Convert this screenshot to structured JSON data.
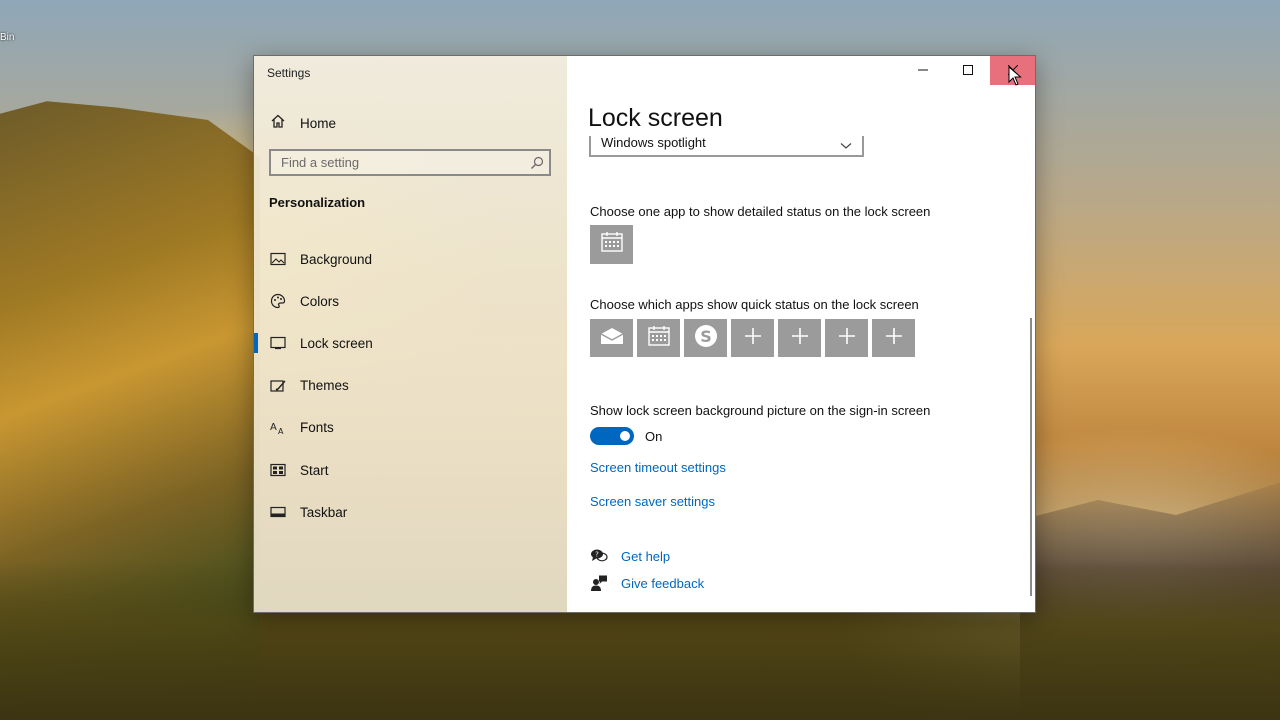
{
  "desktop": {
    "recycle_bin_label": "Bin"
  },
  "window": {
    "title": "Settings",
    "controls": {
      "minimize": "minimize-icon",
      "maximize": "maximize-icon",
      "close": "close-icon"
    }
  },
  "sidebar": {
    "home_label": "Home",
    "search_placeholder": "Find a setting",
    "section_title": "Personalization",
    "items": [
      {
        "label": "Background",
        "icon": "background-picture-icon"
      },
      {
        "label": "Colors",
        "icon": "palette-icon"
      },
      {
        "label": "Lock screen",
        "icon": "lock-screen-icon",
        "active": true
      },
      {
        "label": "Themes",
        "icon": "themes-brush-icon"
      },
      {
        "label": "Fonts",
        "icon": "fonts-icon"
      },
      {
        "label": "Start",
        "icon": "start-grid-icon"
      },
      {
        "label": "Taskbar",
        "icon": "taskbar-icon"
      }
    ]
  },
  "content": {
    "page_title": "Lock screen",
    "background_dropdown_value": "Windows spotlight",
    "detailed_status_label": "Choose one app to show detailed status on the lock screen",
    "detailed_status_app": "calendar-icon",
    "quick_status_label": "Choose which apps show quick status on the lock screen",
    "quick_status_apps": [
      "mail-icon",
      "calendar-icon",
      "skype-icon",
      "plus-icon",
      "plus-icon",
      "plus-icon",
      "plus-icon"
    ],
    "signin_bg_label": "Show lock screen background picture on the sign-in screen",
    "signin_bg_toggle_state": "On",
    "screen_timeout_link": "Screen timeout settings",
    "screen_saver_link": "Screen saver settings",
    "get_help": "Get help",
    "give_feedback": "Give feedback"
  },
  "colors": {
    "accent": "#0067c0",
    "tile": "#9b9b9b",
    "close_hover": "#e8707c"
  }
}
